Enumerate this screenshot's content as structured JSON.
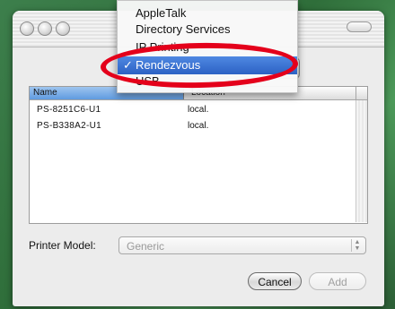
{
  "menu": {
    "items": [
      {
        "label": "AppleTalk",
        "checked": false
      },
      {
        "label": "Directory Services",
        "checked": false
      },
      {
        "label": "IP Printing",
        "checked": false
      },
      {
        "label": "Rendezvous",
        "checked": true
      },
      {
        "label": "USB",
        "checked": false
      }
    ],
    "check_mark": "✓"
  },
  "printer_list": {
    "columns": [
      "Name",
      "Location"
    ],
    "rows": [
      {
        "name": "PS-8251C6-U1",
        "location": "local."
      },
      {
        "name": "PS-B338A2-U1",
        "location": "local."
      }
    ]
  },
  "printer_model": {
    "label": "Printer Model:",
    "value": "Generic"
  },
  "buttons": {
    "cancel": "Cancel",
    "add": "Add"
  },
  "annotation_color": "#e4001b",
  "icons": [
    "close-light-icon",
    "minimize-light-icon",
    "zoom-light-icon",
    "popup-arrows-icon",
    "stepper-arrows-icon"
  ]
}
